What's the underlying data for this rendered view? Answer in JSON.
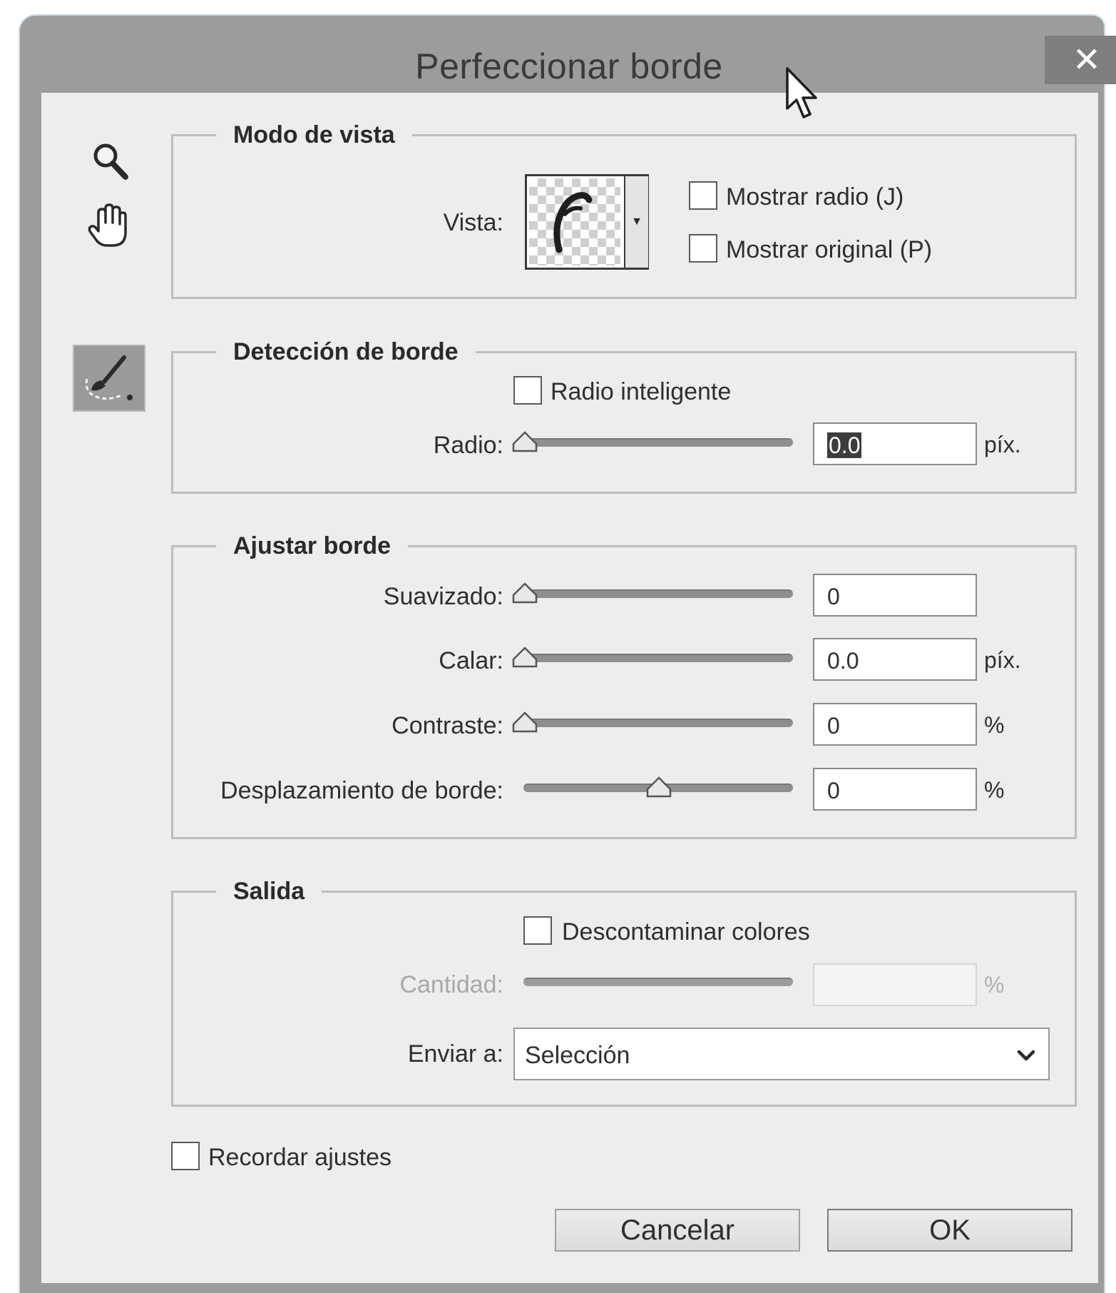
{
  "window": {
    "title": "Perfeccionar borde",
    "close_glyph": "✕"
  },
  "view_mode": {
    "legend": "Modo de vista",
    "vista_label": "Vista:",
    "vista_selected_icon": "marching-ants-on-transparent-icon",
    "show_radius_label": "Mostrar radio (J)",
    "show_radius_checked": false,
    "show_original_label": "Mostrar original (P)",
    "show_original_checked": false
  },
  "edge_detection": {
    "legend": "Detección de borde",
    "smart_radius_label": "Radio inteligente",
    "smart_radius_checked": false,
    "radius_label": "Radio:",
    "radius_value": "0.0",
    "radius_unit": "píx.",
    "radius_slider_fraction": 0.0
  },
  "adjust_edge": {
    "legend": "Ajustar borde",
    "rows": [
      {
        "label": "Suavizado:",
        "value": "0",
        "unit": "",
        "slider_fraction": 0.0
      },
      {
        "label": "Calar:",
        "value": "0.0",
        "unit": "píx.",
        "slider_fraction": 0.0
      },
      {
        "label": "Contraste:",
        "value": "0",
        "unit": "%",
        "slider_fraction": 0.0
      },
      {
        "label": "Desplazamiento de borde:",
        "value": "0",
        "unit": "%",
        "slider_fraction": 0.5
      }
    ]
  },
  "output": {
    "legend": "Salida",
    "decontaminate_label": "Descontaminar colores",
    "decontaminate_checked": false,
    "amount_label": "Cantidad:",
    "amount_value": "",
    "amount_unit": "%",
    "send_to_label": "Enviar a:",
    "send_to_value": "Selección"
  },
  "remember_label": "Recordar ajustes",
  "remember_checked": false,
  "buttons": {
    "cancel": "Cancelar",
    "ok": "OK"
  },
  "colors": {
    "title_bar": "#9c9c9c",
    "client_bg": "#ededed",
    "close_bg": "#7e7e7e"
  }
}
